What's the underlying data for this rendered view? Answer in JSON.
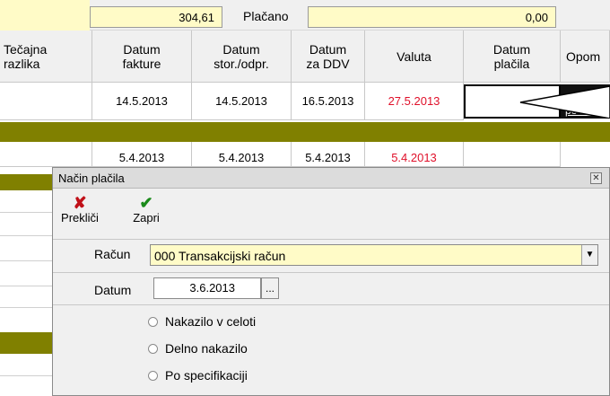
{
  "top": {
    "amount_left": "304,61",
    "placano_label": "Plačano",
    "amount_right": "0,00"
  },
  "columns": {
    "tecajna": "Tečajna\nrazlika",
    "datum_fakture": "Datum\nfakture",
    "datum_stor": "Datum\nstor./odpr.",
    "datum_ddv": "Datum\nza DDV",
    "valuta": "Valuta",
    "datum_placila": "Datum\nplačila",
    "opomba": "Opom"
  },
  "rows": [
    {
      "fakture": "14.5.2013",
      "stor": "14.5.2013",
      "ddv": "16.5.2013",
      "valuta": "27.5.2013"
    },
    {
      "fakture": "5.4.2013",
      "stor": "5.4.2013",
      "ddv": "5.4.2013",
      "valuta": "5.4.2013"
    }
  ],
  "tooltip_text": "po zelj",
  "colors": {
    "olive": "#808000",
    "yellow_field": "#fffbc7",
    "red_text": "#e0102a"
  },
  "dialog": {
    "title": "Način plačila",
    "close_icon": "close-icon",
    "toolbar": [
      {
        "label": "Prekliči",
        "icon": "red-x-icon"
      },
      {
        "label": "Zapri",
        "icon": "green-check-icon"
      }
    ],
    "racun_label": "Račun",
    "racun_value": "000  Transakcijski račun",
    "datum_label": "Datum",
    "datum_value": "3.6.2013",
    "ellipsis": "...",
    "options": [
      "Nakazilo v celoti",
      "Delno nakazilo",
      "Po specifikaciji"
    ]
  }
}
